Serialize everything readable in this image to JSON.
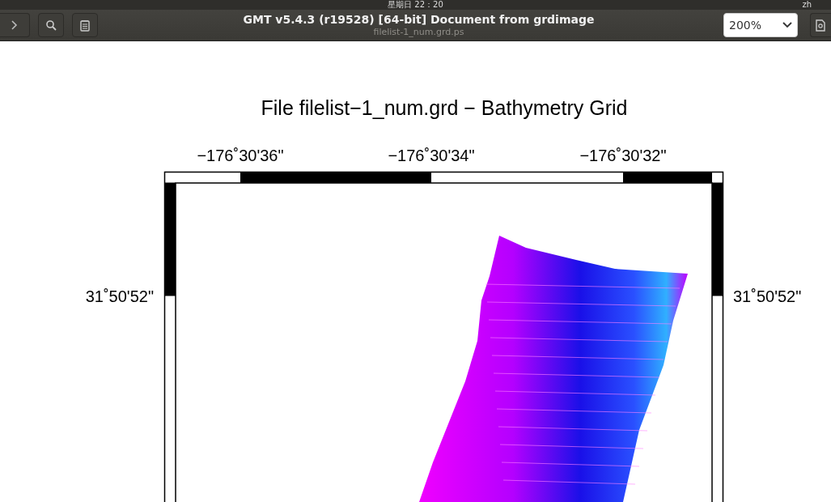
{
  "top_bar": {
    "clock": "星期日 22：20",
    "input_method": "zh"
  },
  "toolbar": {
    "title": "GMT v5.4.3 (r19528) [64-bit] Document from grdimage",
    "subtitle": "filelist-1_num.grd.ps",
    "zoom": "200%"
  },
  "document": {
    "plot_title": "File filelist−1_num.grd − Bathymetry Grid",
    "top_axis_labels": [
      "−176˚30'36\"",
      "−176˚30'34\"",
      "−176˚30'32\""
    ],
    "left_axis_labels": [
      "31˚50'52\""
    ],
    "right_axis_labels": [
      "31˚50'52\""
    ]
  }
}
